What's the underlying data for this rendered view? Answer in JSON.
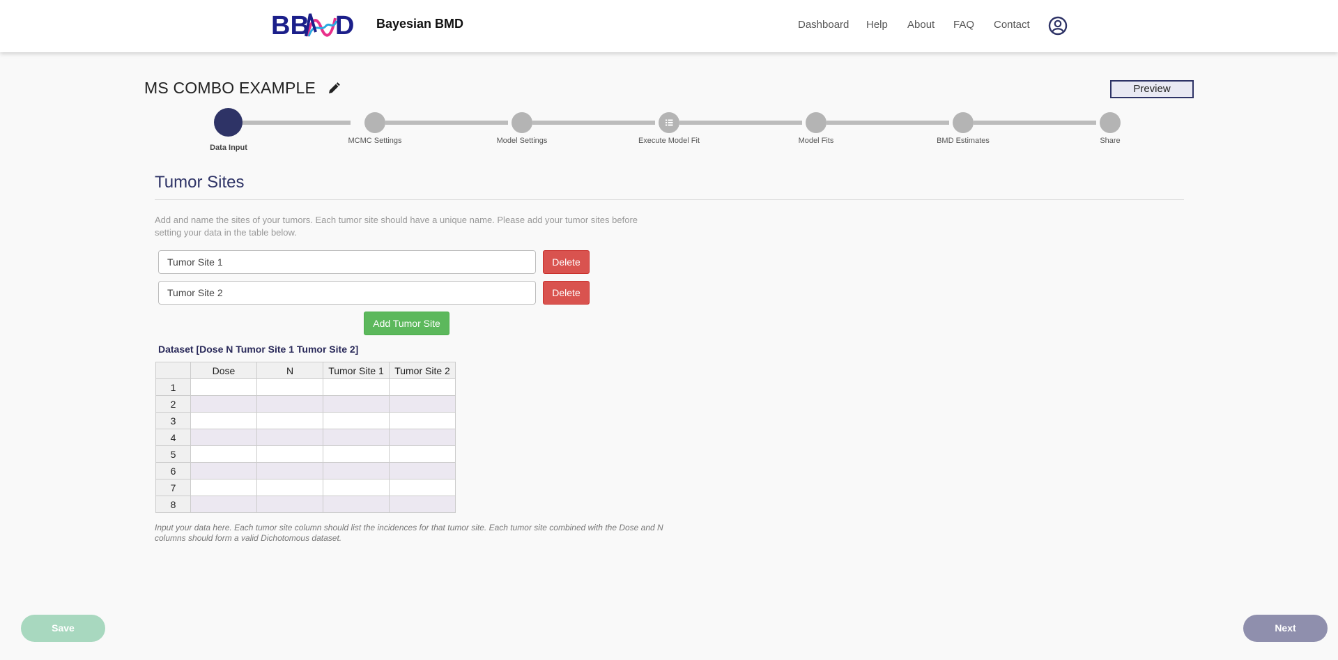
{
  "header": {
    "brand": "Bayesian BMD",
    "nav": [
      "Dashboard",
      "Help",
      "About",
      "FAQ",
      "Contact"
    ],
    "user_icon": "user-circle-icon"
  },
  "project": {
    "title": "MS COMBO EXAMPLE",
    "edit_icon": "pencil-icon",
    "preview_label": "Preview"
  },
  "stepper": {
    "steps": [
      "Data Input",
      "MCMC Settings",
      "Model Settings",
      "Execute Model Fit",
      "Model Fits",
      "BMD Estimates",
      "Share"
    ],
    "active_index": 0,
    "active_color": "#2e3366"
  },
  "section": {
    "title": "Tumor Sites",
    "description": "Add and name the sites of your tumors. Each tumor site should have a unique name. Please add your tumor sites before setting your data in the table below.",
    "sites": [
      {
        "value": "Tumor Site 1",
        "delete_label": "Delete"
      },
      {
        "value": "Tumor Site 2",
        "delete_label": "Delete"
      }
    ],
    "add_label": "Add Tumor Site"
  },
  "dataset": {
    "title": "Dataset [Dose N Tumor Site 1 Tumor Site 2]",
    "columns": [
      "Dose",
      "N",
      "Tumor Site 1",
      "Tumor Site 2"
    ],
    "rows": [
      "1",
      "2",
      "3",
      "4",
      "5",
      "6",
      "7",
      "8"
    ],
    "note": "Input your data here. Each tumor site column should list the incidences for that tumor site. Each tumor site combined with the Dose and N columns should form a valid Dichotomous dataset."
  },
  "footer": {
    "save_label": "Save",
    "next_label": "Next"
  },
  "colors": {
    "accent": "#2e3366",
    "delete": "#d9534f",
    "add": "#5cb85c",
    "save": "#a8d8bf",
    "next": "#8f8fad"
  }
}
